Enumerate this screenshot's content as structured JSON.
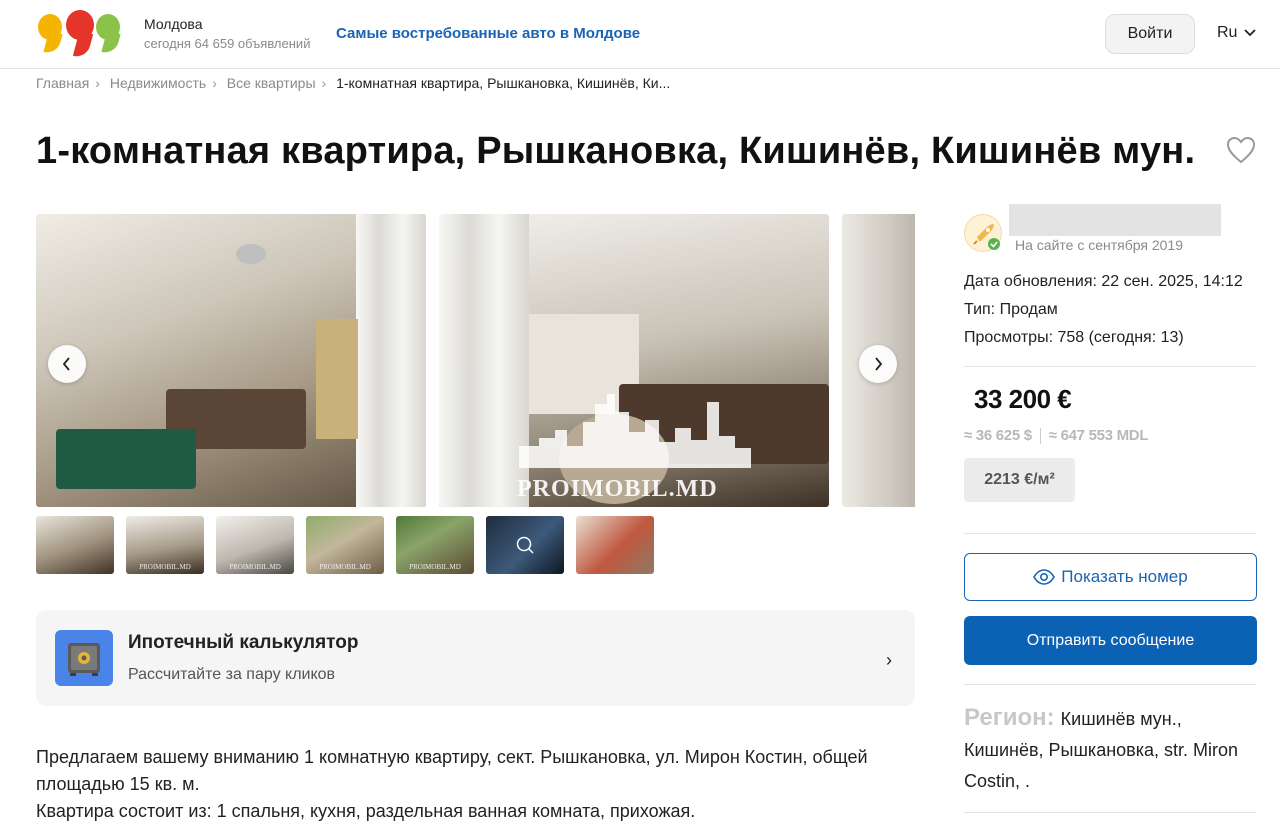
{
  "header": {
    "region": "Молдова",
    "listings_today": "сегодня 64 659 объявлений",
    "headline_link": "Самые востребованные авто в Молдове",
    "login_label": "Войти",
    "language": "Ru"
  },
  "breadcrumb": {
    "items": [
      "Главная",
      "Недвижимость",
      "Все квартиры",
      "1-комнатная квартира, Рышкановка, Кишинёв, Ки..."
    ]
  },
  "listing": {
    "title": "1-комнатная квартира, Рышкановка, Кишинёв, Кишинёв мун.",
    "watermark": "PROIMOBIL.MD",
    "thumb_watermark": "PROIMOBIL.MD"
  },
  "calculator": {
    "title": "Ипотечный калькулятор",
    "subtitle": "Рассчитайте за пару кликов",
    "arrow": "›"
  },
  "description": {
    "lines": [
      "Предлагаем вашему вниманию 1 комнатную квартиру, сект. Рышкановка, ул. Мирон Костин, общей площадью 15 кв. м.",
      "Квартира состоит из: 1 спальня, кухня, раздельная ванная комната, прихожая."
    ]
  },
  "seller": {
    "since": "На сайте с сентября 2019"
  },
  "details": {
    "updated": "Дата обновления: 22 сен. 2025, 14:12",
    "type": "Тип: Продам",
    "views": "Просмотры: 758 (сегодня: 13)"
  },
  "price": {
    "main": "33 200 €",
    "usd": "≈ 36 625 $",
    "mdl": "≈ 647 553 MDL",
    "per_m2": "2213 €/м²"
  },
  "actions": {
    "show_phone": "Показать номер",
    "send_message": "Отправить сообщение"
  },
  "location": {
    "label": "Регион:",
    "value": "Кишинёв мун., Кишинёв, Рышкановка, str. Miron Costin, ."
  },
  "colors": {
    "brand_blue": "#0b62b4",
    "link_blue": "#1b63b5",
    "logo_yellow": "#f5b400",
    "logo_red": "#e5352b",
    "logo_green": "#8bc34a"
  }
}
